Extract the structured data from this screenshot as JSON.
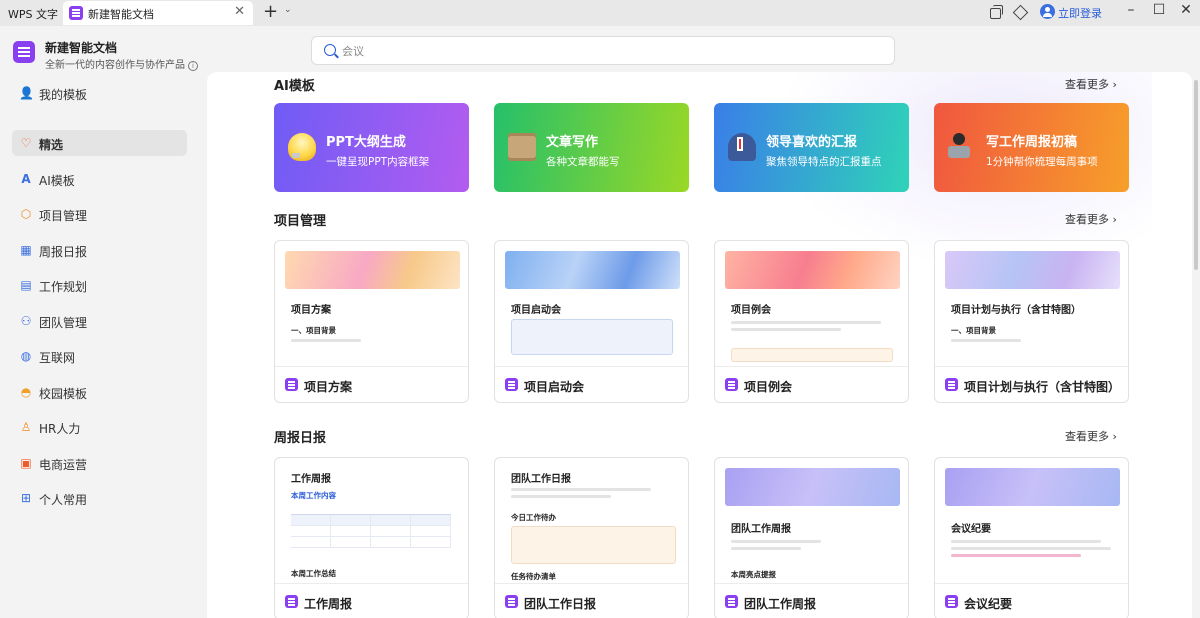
{
  "titlebar": {
    "app_label": "WPS 文字",
    "tab_label": "新建智能文档",
    "tab_close": "✕",
    "new_tab": "+",
    "new_tab_menu": "⌄",
    "login_label": "立即登录",
    "minimize": "–",
    "maximize": "☐",
    "close": "✕"
  },
  "header": {
    "brand_title": "新建智能文档",
    "brand_subtitle": "全新一代的内容创作与协作产品",
    "search_placeholder": "会议"
  },
  "sidebar": {
    "items": [
      {
        "label": "我的模板",
        "icon": "person-icon",
        "glyph": "👤",
        "color": "#3b6fe0"
      },
      {
        "label": "精选",
        "icon": "heart-icon",
        "glyph": "♡",
        "color": "#f05a28"
      },
      {
        "label": "AI模板",
        "icon": "ai-icon",
        "glyph": "A",
        "color": "#3b6fe0"
      },
      {
        "label": "项目管理",
        "icon": "cube-icon",
        "glyph": "⬡",
        "color": "#f08a28"
      },
      {
        "label": "周报日报",
        "icon": "calendar-icon",
        "glyph": "▦",
        "color": "#3b6fe0"
      },
      {
        "label": "工作规划",
        "icon": "clipboard-icon",
        "glyph": "▤",
        "color": "#3b6fe0"
      },
      {
        "label": "团队管理",
        "icon": "team-icon",
        "glyph": "⚇",
        "color": "#3b6fe0"
      },
      {
        "label": "互联网",
        "icon": "globe-icon",
        "glyph": "◍",
        "color": "#3b6fe0"
      },
      {
        "label": "校园模板",
        "icon": "graduation-cap-icon",
        "glyph": "◓",
        "color": "#f0a028"
      },
      {
        "label": "HR人力",
        "icon": "person-outline-icon",
        "glyph": "♙",
        "color": "#f08a28"
      },
      {
        "label": "电商运营",
        "icon": "shop-icon",
        "glyph": "▣",
        "color": "#f05a28"
      },
      {
        "label": "个人常用",
        "icon": "grid-icon",
        "glyph": "⊞",
        "color": "#3b6fe0"
      }
    ],
    "active_index": 1
  },
  "sections": {
    "ai": {
      "title": "AI模板",
      "more": "查看更多 ›"
    },
    "project": {
      "title": "项目管理",
      "more": "查看更多 ›"
    },
    "weekly": {
      "title": "周报日报",
      "more": "查看更多 ›"
    }
  },
  "ai_cards": [
    {
      "title": "PPT大纲生成",
      "subtitle": "一键呈现PPT内容框架",
      "icon": "lightbulb-icon"
    },
    {
      "title": "文章写作",
      "subtitle": "各种文章都能写",
      "icon": "scroll-icon"
    },
    {
      "title": "领导喜欢的汇报",
      "subtitle": "聚焦领导特点的汇报重点",
      "icon": "suit-icon"
    },
    {
      "title": "写工作周报初稿",
      "subtitle": "1分钟帮你梳理每周事项",
      "icon": "laptop-user-icon"
    }
  ],
  "project_cards": [
    {
      "label": "项目方案",
      "preview_title": "项目方案",
      "preview_heading": "一、项目背景"
    },
    {
      "label": "项目启动会",
      "preview_title": "项目启动会"
    },
    {
      "label": "项目例会",
      "preview_title": "项目例会"
    },
    {
      "label": "项目计划与执行（含甘特图）",
      "preview_title": "项目计划与执行（含甘特图）",
      "preview_heading": "一、项目背景"
    }
  ],
  "weekly_cards": [
    {
      "label": "工作周报",
      "preview_title": "工作周报",
      "preview_heading": "本周工作内容",
      "preview_footer": "本周工作总结"
    },
    {
      "label": "团队工作日报",
      "preview_title": "团队工作日报",
      "preview_heading": "今日工作待办",
      "preview_footer": "任务待办清单"
    },
    {
      "label": "团队工作周报",
      "preview_title": "团队工作周报",
      "preview_footer": "本周亮点提报"
    },
    {
      "label": "会议纪要",
      "preview_title": "会议纪要"
    }
  ]
}
